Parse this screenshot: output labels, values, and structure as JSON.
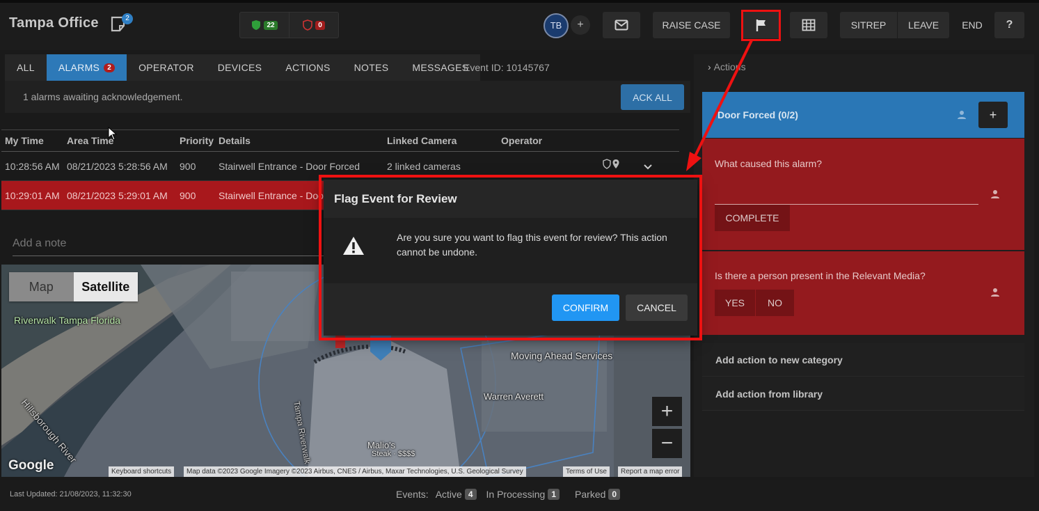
{
  "header": {
    "office": "Tampa Office",
    "notes_count": "2",
    "shield_green_count": "22",
    "shield_red_count": "0",
    "user_initials": "TB",
    "add_user": "+",
    "raise_case": "RAISE CASE",
    "sitrep": "SITREP",
    "leave": "LEAVE",
    "end": "END",
    "help": "?"
  },
  "tabs": [
    {
      "label": "ALL"
    },
    {
      "label": "ALARMS",
      "count": "2"
    },
    {
      "label": "OPERATOR"
    },
    {
      "label": "DEVICES"
    },
    {
      "label": "ACTIONS"
    },
    {
      "label": "NOTES"
    },
    {
      "label": "MESSAGES"
    }
  ],
  "event_id": "Event ID: 10145767",
  "ack": {
    "message": "1 alarms awaiting acknowledgement.",
    "button": "ACK ALL"
  },
  "table": {
    "columns": [
      "My Time",
      "Area Time",
      "Priority",
      "Details",
      "Linked Camera",
      "Operator"
    ],
    "rows": [
      {
        "my_time": "10:28:56 AM",
        "area_time": "08/21/2023 5:28:56 AM",
        "priority": "900",
        "details": "Stairwell Entrance - Door Forced",
        "camera": "2 linked cameras",
        "operator": ""
      },
      {
        "my_time": "10:29:01 AM",
        "area_time": "08/21/2023 5:29:01 AM",
        "priority": "900",
        "details": "Stairwell Entrance - Door Forced",
        "camera": "",
        "operator": ""
      }
    ]
  },
  "note_placeholder": "Add a note",
  "map": {
    "toggle_map": "Map",
    "toggle_satellite": "Satellite",
    "labels": {
      "riverwalk": "Riverwalk Tampa Florida",
      "river": "Hillsborough River",
      "moving": "Moving Ahead Services",
      "warren": "Warren Averett",
      "tampa_riverwalk": "Tampa Riverwalk",
      "malios": "Malio's",
      "malios_sub": "Steak · $$$$"
    },
    "zoom_in": "+",
    "zoom_out": "−",
    "google": "Google",
    "footer": {
      "shortcuts": "Keyboard shortcuts",
      "data": "Map data ©2023 Google Imagery ©2023 Airbus, CNES / Airbus, Maxar Technologies, U.S. Geological Survey",
      "terms": "Terms of Use",
      "report": "Report a map error"
    }
  },
  "actions_panel": {
    "header": "Actions",
    "category": "Door Forced (0/2)",
    "add": "+",
    "q1": "What caused this alarm?",
    "complete": "COMPLETE",
    "q2": "Is there a person present in the Relevant Media?",
    "yes": "YES",
    "no": "NO",
    "add_new_category": "Add action to new category",
    "add_from_library": "Add action from library"
  },
  "footer": {
    "last_updated": "Last Updated: 21/08/2023, 11:32:30",
    "events_label": "Events:",
    "active_label": "Active",
    "active_count": "4",
    "processing_label": "In Processing",
    "processing_count": "1",
    "parked_label": "Parked",
    "parked_count": "0"
  },
  "modal": {
    "title": "Flag Event for Review",
    "message": "Are you sure you want to flag this event for review? This action cannot be undone.",
    "confirm": "CONFIRM",
    "cancel": "CANCEL"
  },
  "colors": {
    "accent_blue": "#2d79b8",
    "alarm_red": "#a8181c",
    "annotation_red": "#ee1111",
    "confirm_blue": "#2196f3"
  }
}
